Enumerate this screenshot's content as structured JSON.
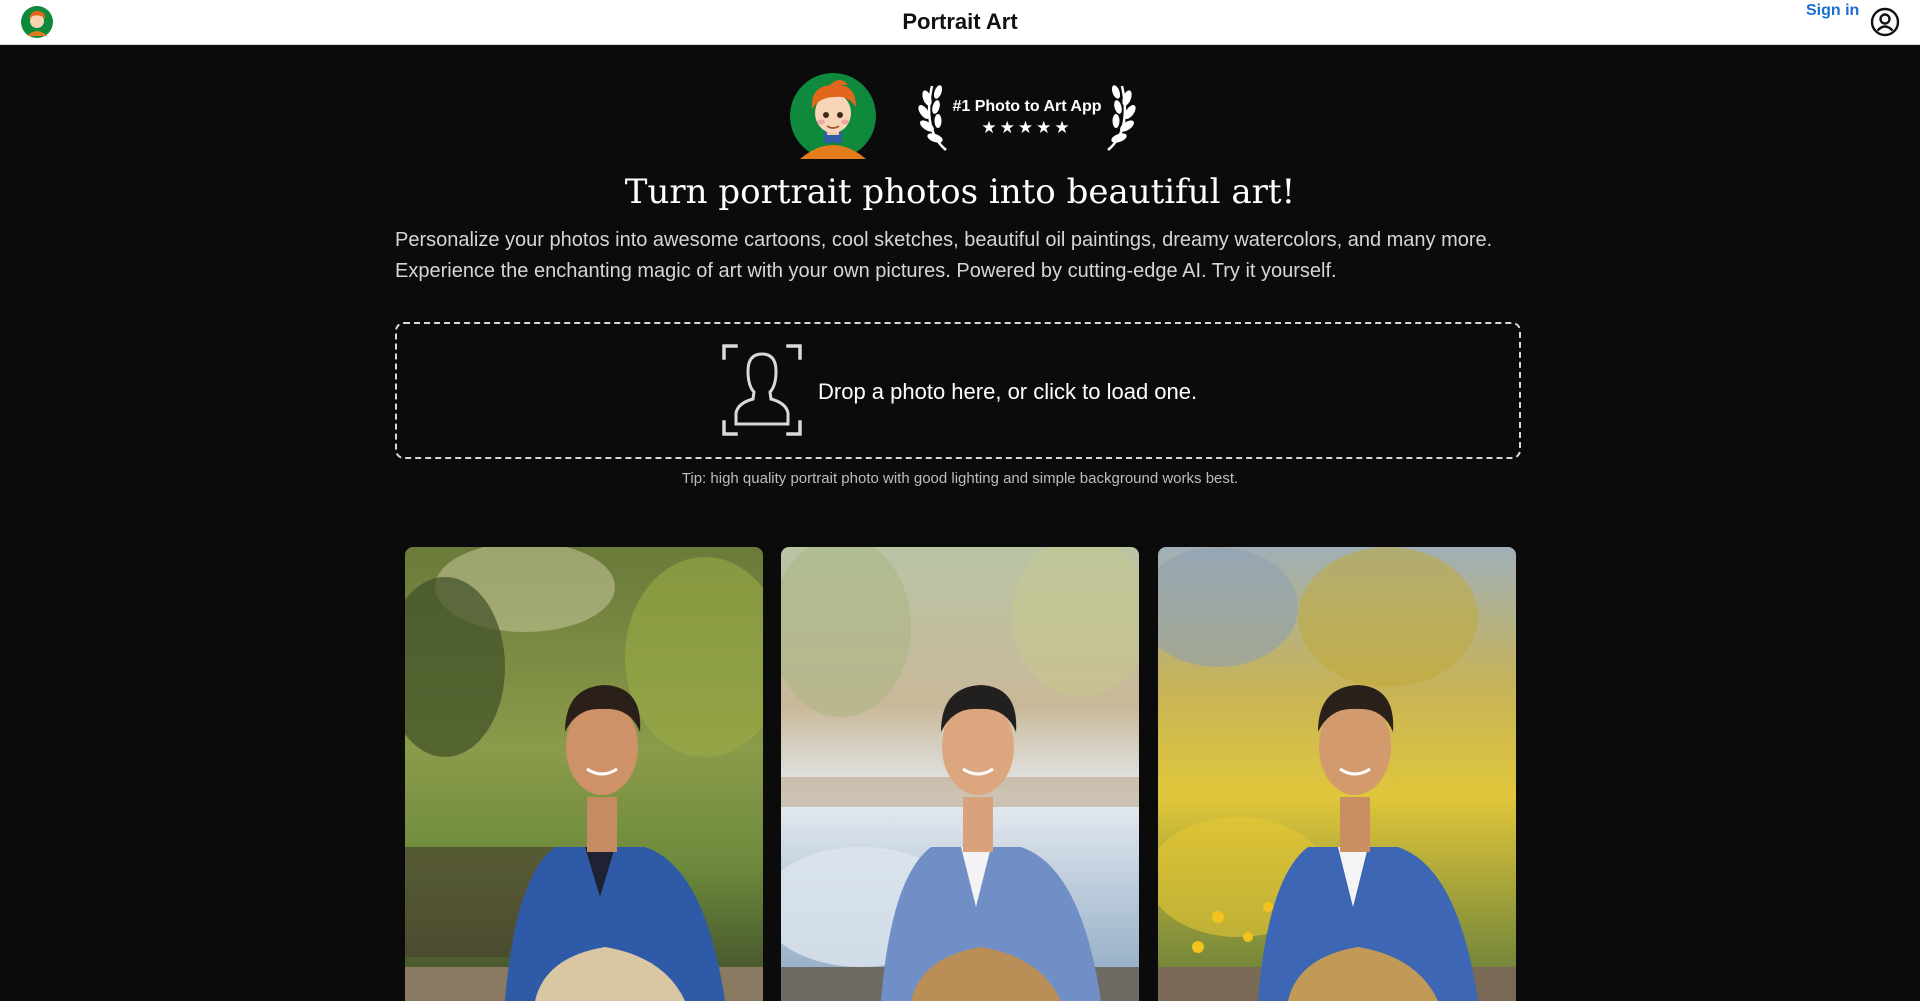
{
  "header": {
    "app_title": "Portrait Art",
    "signin_label": "Sign in",
    "logo_icon": "cartoon-avatar-logo",
    "account_icon": "account-circle-icon"
  },
  "hero": {
    "badge_text": "#1 Photo to Art App",
    "badge_stars": "★★★★★",
    "headline": "Turn portrait photos into beautiful art!",
    "intro_line_1": "Personalize your photos into awesome cartoons, cool sketches, beautiful oil paintings, dreamy watercolors, and many more.",
    "intro_line_2": "Experience the enchanting magic of art with your own pictures. Powered by cutting-edge AI. Try it yourself."
  },
  "upload": {
    "drop_text": "Drop a photo here, or click to load one.",
    "tip": "Tip: high quality portrait photo with good lighting and simple background works best.",
    "icon": "portrait-frame-icon"
  },
  "gallery": [
    {
      "name": "original-photo"
    },
    {
      "name": "watercolor-painting"
    },
    {
      "name": "oil-painting"
    }
  ],
  "colors": {
    "background": "#0b0b0b",
    "topbar": "#ffffff",
    "link": "#1a6fd1",
    "avatar_green": "#0f8a3c"
  }
}
